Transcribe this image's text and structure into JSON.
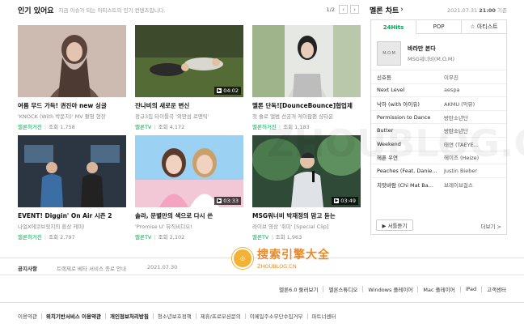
{
  "section": {
    "title": "인기 있어요",
    "subtitle": "지금 이슈가 되는 아티스트의 인기 컨텐츠입니다.",
    "page": "1/2"
  },
  "cards": [
    {
      "title": "여름 무드 가득! 권진아 new 싱글",
      "subtitle": "'KNOCK (With 박문치)' MV 촬영 현장",
      "channel": "멜론허거진",
      "views": "조회 1,758",
      "duration": ""
    },
    {
      "title": "잔나비의 새로운 변신",
      "subtitle": "정규3집 타이틀곡 '외딴섬 로맨틱'",
      "channel": "멜론TV",
      "views": "조회 4,172",
      "duration": "04:02"
    },
    {
      "title": "멜론 단독![DounceBounce]협업제",
      "subtitle": "첫 솔로 앨범 선공개 케이팝팬 샹타운",
      "channel": "멜론허거진",
      "views": "조회 1,183",
      "duration": ""
    },
    {
      "title": "EVENT! Diggin' On Air 시즌 2",
      "subtitle": "나얼X에코브릿지의 환상 케미!",
      "channel": "멜론허거진",
      "views": "조회 2,797",
      "duration": ""
    },
    {
      "title": "솔라, 문별만의 색으로 다시 쓴",
      "subtitle": "'Promise U' 뮤직비디오!",
      "channel": "멜론TV",
      "views": "조회 2,102",
      "duration": "03:33"
    },
    {
      "title": "MSG워너비 박재정의 맘고 듣는",
      "subtitle": "라이브 영상 '취미' [Special Clip]",
      "channel": "멜론TV",
      "views": "조회 1,963",
      "duration": "03:49"
    }
  ],
  "chart": {
    "title": "멜론 차트",
    "date": "2021.07.31",
    "time": "21:00",
    "date_suffix": "기준",
    "tabs": [
      "24Hits",
      "POP",
      "☆ 아티스트"
    ],
    "top": {
      "title": "바라만 본다",
      "artist": "MSG워너비(M.O.M)",
      "album_text": "M.O.M"
    },
    "rows": [
      {
        "song": "신호등",
        "artist": "이무진"
      },
      {
        "song": "Next Level",
        "artist": "aespa"
      },
      {
        "song": "낙하 (with 아이유)",
        "artist": "AKMU (악뮤)"
      },
      {
        "song": "Permission to Dance",
        "artist": "방탄소년단"
      },
      {
        "song": "Butter",
        "artist": "방탄소년단"
      },
      {
        "song": "Weekend",
        "artist": "태연 (TAEYE..."
      },
      {
        "song": "헤픈 우연",
        "artist": "헤이즈 (Heize)"
      },
      {
        "song": "Peaches (Feat. Danie...",
        "artist": "Justin Bieber"
      },
      {
        "song": "치맛바람 (Chi Mat Ba...",
        "artist": "브레이브걸스"
      }
    ],
    "listen": "▶ 서틀듣기",
    "more": "더보기 >"
  },
  "notice": {
    "label": "공지사항",
    "text": "트랙제로 베타 서비스 종료 안내",
    "date": "2021.07.30"
  },
  "apps": [
    "멜론6.0 둘러보기",
    "멜론스튜디오",
    "Windows 플레이어",
    "Mac 플레이어",
    "iPad",
    "고객센터"
  ],
  "links": [
    {
      "text": "이용약관",
      "bold": false
    },
    {
      "text": "위치기반서비스 이용약관",
      "bold": true
    },
    {
      "text": "개인정보처리방침",
      "bold": true
    },
    {
      "text": "청소년보호정책",
      "bold": false
    },
    {
      "text": "제휴/프로모션문의",
      "bold": false
    },
    {
      "text": "이메일주소무단수집거부",
      "bold": false
    },
    {
      "text": "파트너센터",
      "bold": false
    }
  ],
  "watermark": {
    "big": "搜索引擎大全",
    "small": "ZHOUBLOG.CN"
  }
}
